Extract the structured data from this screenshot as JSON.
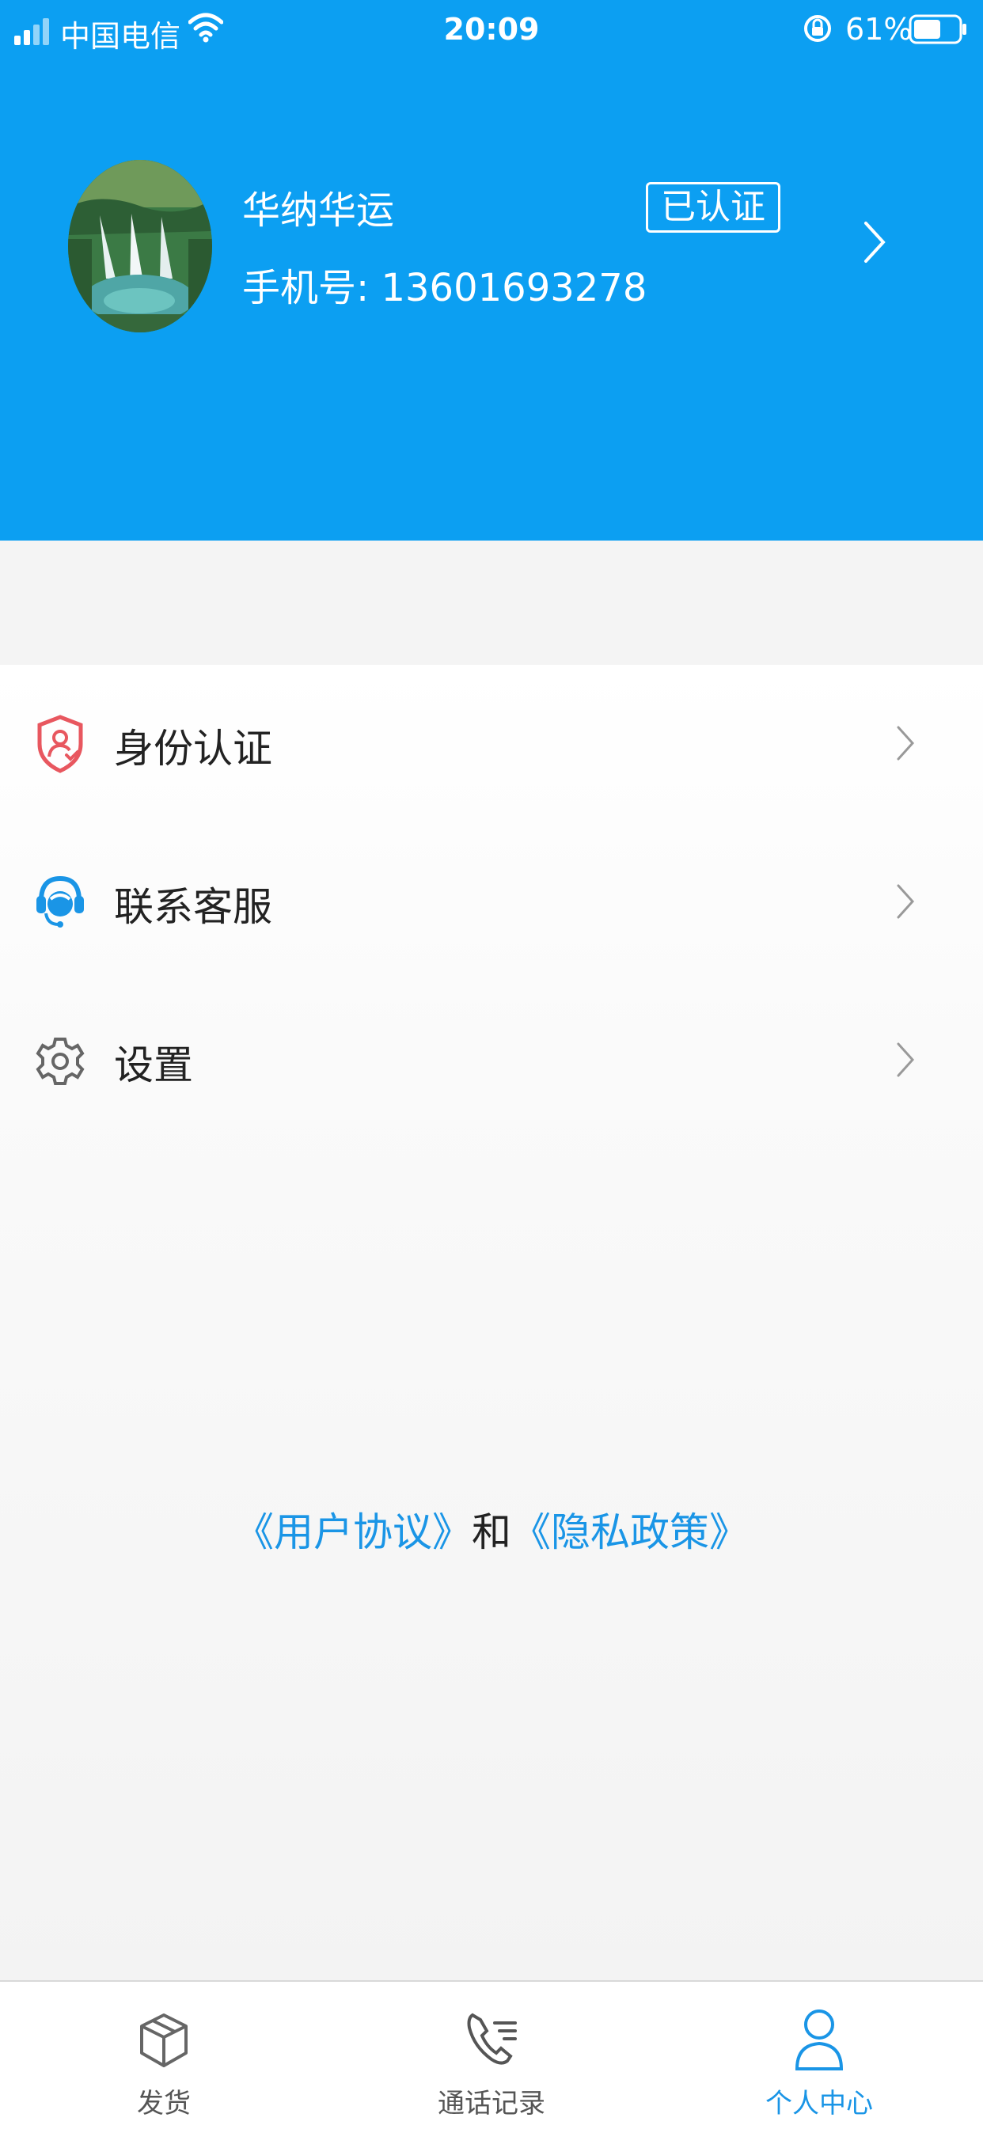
{
  "status_bar": {
    "carrier": "中国电信",
    "time": "20:09",
    "battery_percent": "61%",
    "battery_level": 0.61
  },
  "profile": {
    "name": "华纳华运",
    "verified_badge": "已认证",
    "phone_label": "手机号:",
    "phone_number": "13601693278"
  },
  "menu": {
    "items": [
      {
        "label": "身份认证",
        "icon": "shield-user-icon"
      },
      {
        "label": "联系客服",
        "icon": "headset-agent-icon"
      },
      {
        "label": "设置",
        "icon": "gear-icon"
      }
    ]
  },
  "agreement": {
    "user_agreement": "《用户协议》",
    "conjunction": "和",
    "privacy_policy": "《隐私政策》"
  },
  "tabbar": {
    "tabs": [
      {
        "label": "发货",
        "icon": "package-box-icon"
      },
      {
        "label": "通话记录",
        "icon": "phone-list-icon"
      },
      {
        "label": "个人中心",
        "icon": "person-icon",
        "active": true
      }
    ]
  },
  "colors": {
    "primary": "#0c9ff2",
    "link": "#1a95e6",
    "shield": "#e8575f"
  }
}
